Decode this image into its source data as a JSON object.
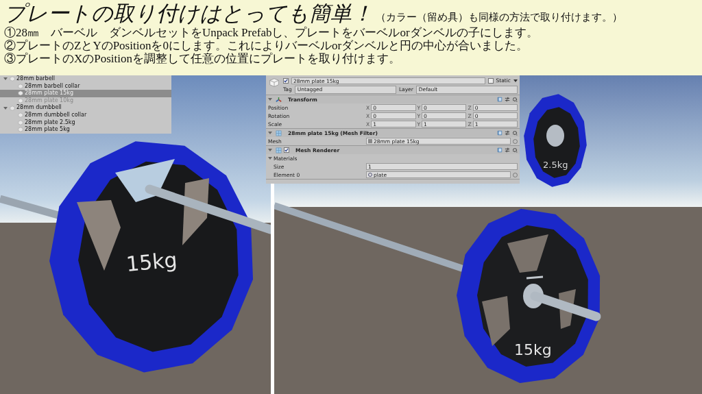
{
  "heading": {
    "title": "プレートの取り付けはとっても簡単！",
    "note": "（カラー（留め具）も同様の方法で取り付けます。）"
  },
  "steps": [
    "①28㎜　バーベル　ダンベルセットをUnpack Prefabし、プレートをバーベルorダンベルの子にします。",
    "②プレートのZとYのPositionを0にします。これによりバーベルorダンベルと円の中心が合いました。",
    "③プレートのXのPositionを調整して任意の位置にプレートを取り付けます。"
  ],
  "hierarchy": {
    "items": [
      {
        "label": "28mm barbell",
        "expanded": true,
        "selected": false,
        "disabled": false,
        "children": [
          {
            "label": "28mm barbell collar",
            "selected": false,
            "disabled": false
          },
          {
            "label": "28mm plate 15kg",
            "selected": true,
            "disabled": false
          },
          {
            "label": "28mm plate 10kg",
            "selected": false,
            "disabled": true
          }
        ]
      },
      {
        "label": "28mm dumbbell",
        "expanded": true,
        "selected": false,
        "disabled": false,
        "children": [
          {
            "label": "28mm dumbbell collar",
            "selected": false,
            "disabled": false
          },
          {
            "label": "28mm plate 2.5kg",
            "selected": false,
            "disabled": false
          },
          {
            "label": "28mm plate 5kg",
            "selected": false,
            "disabled": false
          }
        ]
      }
    ]
  },
  "inspector": {
    "object_name": "28mm plate 15kg",
    "active": true,
    "static": {
      "label": "Static",
      "checked": false
    },
    "tag": {
      "label": "Tag",
      "value": "Untagged"
    },
    "layer": {
      "label": "Layer",
      "value": "Default"
    },
    "components": [
      {
        "kind": "transform",
        "title": "Transform",
        "expanded": true,
        "rows": [
          {
            "label": "Position",
            "values": [
              {
                "axis": "X",
                "value": "0"
              },
              {
                "axis": "Y",
                "value": "0"
              },
              {
                "axis": "Z",
                "value": "0"
              }
            ]
          },
          {
            "label": "Rotation",
            "values": [
              {
                "axis": "X",
                "value": "0"
              },
              {
                "axis": "Y",
                "value": "0"
              },
              {
                "axis": "Z",
                "value": "0"
              }
            ]
          },
          {
            "label": "Scale",
            "values": [
              {
                "axis": "X",
                "value": "1"
              },
              {
                "axis": "Y",
                "value": "1"
              },
              {
                "axis": "Z",
                "value": "1"
              }
            ]
          }
        ]
      },
      {
        "kind": "mesh_filter",
        "title": "28mm plate 15kg (Mesh Filter)",
        "expanded": true,
        "field": {
          "label": "Mesh",
          "value": "28mm plate 15kg"
        }
      },
      {
        "kind": "mesh_renderer",
        "title": "Mesh Renderer",
        "enabled": true,
        "expanded": true,
        "materials": {
          "label": "Materials",
          "expanded": true,
          "size_label": "Size",
          "size": "1",
          "elements": [
            {
              "label": "Element 0",
              "value": "plate"
            }
          ]
        }
      }
    ]
  },
  "left_viewport": {
    "plate_label": "15kg"
  },
  "right_viewport": {
    "plate_label": "15kg",
    "back_plate_label": "2.5kg"
  }
}
